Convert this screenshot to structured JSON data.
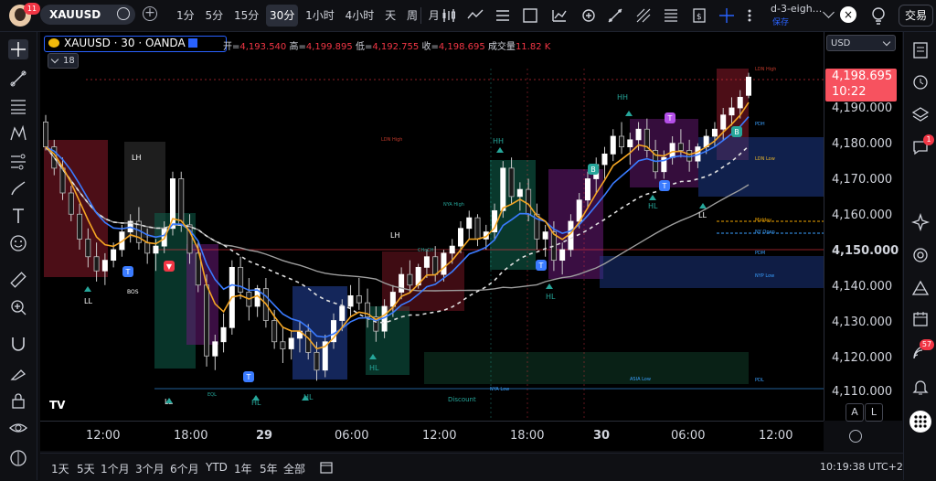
{
  "topbar": {
    "notification_count": "11",
    "symbol": "XAUUSD",
    "intervals": [
      "1分",
      "5分",
      "15分",
      "30分",
      "1小时",
      "4小时",
      "天",
      "周",
      "月"
    ],
    "active_interval": "30分",
    "layout_name": "d-3-eigh...",
    "layout_status": "保存",
    "close": "×",
    "trade_button": "交易"
  },
  "legend": {
    "title": "XAUUSD · 30 · OANDA",
    "collapse_count": "18",
    "open_label": "开=",
    "open": "4,193.540",
    "high_label": "高=",
    "high": "4,199.895",
    "low_label": "低=",
    "low": "4,192.755",
    "close_label": "收=",
    "close": "4,198.695",
    "volume_label": "成交量",
    "volume": "11.82 K"
  },
  "price_axis": {
    "currency": "USD",
    "ticks": [
      "4,190.000",
      "4,180.000",
      "4,170.000",
      "4,160.000",
      "4,150.000",
      "4,140.000",
      "4,130.000",
      "4,120.000",
      "4,110.000"
    ],
    "current_price": "4,198.695",
    "current_time": "10:22",
    "buttons": [
      "A",
      "L"
    ]
  },
  "time_axis": {
    "ticks": [
      "12:00",
      "18:00",
      "29",
      "06:00",
      "12:00",
      "18:00",
      "30",
      "06:00",
      "12:00"
    ]
  },
  "bottom": {
    "ranges": [
      "1天",
      "5天",
      "1个月",
      "3个月",
      "6个月",
      "YTD",
      "1年",
      "5年",
      "全部"
    ],
    "clock": "10:19:38 UTC+2"
  },
  "right_badges": {
    "chat": "1",
    "alerts": "57"
  },
  "chart_labels": {
    "hh": "HH",
    "lh": "LH",
    "ll": "LL",
    "hl": "HL",
    "bos": "BOS",
    "discount": "Discount",
    "ldn_high": "LDN High",
    "ldn_low": "LDN Low",
    "nyam": "NYA High",
    "nya_low": "NYA Low",
    "asia_low": "ASIA Low",
    "pdh": "PDH",
    "pdl": "PDL",
    "midday": "Midday",
    "ny_open": "NY Open",
    "pdm": "PDM",
    "nyp_low": "NYP Low",
    "eql": "EQL",
    "choch": "CHoCH"
  },
  "chart_data": {
    "type": "candlestick",
    "symbol": "XAUUSD",
    "interval": "30",
    "ylim": [
      4105,
      4202
    ],
    "candles": [
      {
        "o": 4186,
        "h": 4188,
        "l": 4178,
        "c": 4179
      },
      {
        "o": 4179,
        "h": 4181,
        "l": 4171,
        "c": 4173
      },
      {
        "o": 4173,
        "h": 4176,
        "l": 4164,
        "c": 4166
      },
      {
        "o": 4166,
        "h": 4168,
        "l": 4158,
        "c": 4160
      },
      {
        "o": 4160,
        "h": 4163,
        "l": 4150,
        "c": 4153
      },
      {
        "o": 4153,
        "h": 4156,
        "l": 4145,
        "c": 4148
      },
      {
        "o": 4148,
        "h": 4152,
        "l": 4141,
        "c": 4144
      },
      {
        "o": 4144,
        "h": 4149,
        "l": 4140,
        "c": 4147
      },
      {
        "o": 4147,
        "h": 4152,
        "l": 4145,
        "c": 4150
      },
      {
        "o": 4150,
        "h": 4157,
        "l": 4148,
        "c": 4155
      },
      {
        "o": 4155,
        "h": 4160,
        "l": 4152,
        "c": 4158
      },
      {
        "o": 4158,
        "h": 4162,
        "l": 4150,
        "c": 4152
      },
      {
        "o": 4152,
        "h": 4156,
        "l": 4146,
        "c": 4149
      },
      {
        "o": 4149,
        "h": 4153,
        "l": 4144,
        "c": 4151
      },
      {
        "o": 4151,
        "h": 4158,
        "l": 4149,
        "c": 4156
      },
      {
        "o": 4156,
        "h": 4172,
        "l": 4154,
        "c": 4170
      },
      {
        "o": 4170,
        "h": 4172,
        "l": 4155,
        "c": 4157
      },
      {
        "o": 4157,
        "h": 4160,
        "l": 4146,
        "c": 4149
      },
      {
        "o": 4149,
        "h": 4152,
        "l": 4138,
        "c": 4140
      },
      {
        "o": 4140,
        "h": 4143,
        "l": 4117,
        "c": 4120
      },
      {
        "o": 4120,
        "h": 4126,
        "l": 4116,
        "c": 4124
      },
      {
        "o": 4124,
        "h": 4132,
        "l": 4121,
        "c": 4128
      },
      {
        "o": 4128,
        "h": 4147,
        "l": 4126,
        "c": 4145
      },
      {
        "o": 4145,
        "h": 4148,
        "l": 4136,
        "c": 4138
      },
      {
        "o": 4138,
        "h": 4142,
        "l": 4130,
        "c": 4134
      },
      {
        "o": 4134,
        "h": 4140,
        "l": 4131,
        "c": 4139
      },
      {
        "o": 4139,
        "h": 4142,
        "l": 4128,
        "c": 4130
      },
      {
        "o": 4130,
        "h": 4133,
        "l": 4122,
        "c": 4124
      },
      {
        "o": 4124,
        "h": 4128,
        "l": 4118,
        "c": 4122
      },
      {
        "o": 4122,
        "h": 4127,
        "l": 4119,
        "c": 4125
      },
      {
        "o": 4125,
        "h": 4130,
        "l": 4121,
        "c": 4127
      },
      {
        "o": 4127,
        "h": 4129,
        "l": 4119,
        "c": 4121
      },
      {
        "o": 4121,
        "h": 4124,
        "l": 4113,
        "c": 4116
      },
      {
        "o": 4116,
        "h": 4126,
        "l": 4114,
        "c": 4124
      },
      {
        "o": 4124,
        "h": 4132,
        "l": 4122,
        "c": 4130
      },
      {
        "o": 4130,
        "h": 4136,
        "l": 4127,
        "c": 4134
      },
      {
        "o": 4134,
        "h": 4140,
        "l": 4131,
        "c": 4137
      },
      {
        "o": 4137,
        "h": 4142,
        "l": 4133,
        "c": 4135
      },
      {
        "o": 4135,
        "h": 4139,
        "l": 4128,
        "c": 4131
      },
      {
        "o": 4131,
        "h": 4134,
        "l": 4124,
        "c": 4127
      },
      {
        "o": 4127,
        "h": 4136,
        "l": 4125,
        "c": 4134
      },
      {
        "o": 4134,
        "h": 4140,
        "l": 4131,
        "c": 4138
      },
      {
        "o": 4138,
        "h": 4145,
        "l": 4136,
        "c": 4143
      },
      {
        "o": 4143,
        "h": 4147,
        "l": 4138,
        "c": 4140
      },
      {
        "o": 4140,
        "h": 4146,
        "l": 4139,
        "c": 4145
      },
      {
        "o": 4145,
        "h": 4150,
        "l": 4142,
        "c": 4148
      },
      {
        "o": 4148,
        "h": 4151,
        "l": 4141,
        "c": 4143
      },
      {
        "o": 4143,
        "h": 4150,
        "l": 4141,
        "c": 4149
      },
      {
        "o": 4149,
        "h": 4153,
        "l": 4146,
        "c": 4151
      },
      {
        "o": 4151,
        "h": 4158,
        "l": 4149,
        "c": 4156
      },
      {
        "o": 4156,
        "h": 4161,
        "l": 4153,
        "c": 4159
      },
      {
        "o": 4159,
        "h": 4160,
        "l": 4151,
        "c": 4153
      },
      {
        "o": 4153,
        "h": 4157,
        "l": 4150,
        "c": 4155
      },
      {
        "o": 4155,
        "h": 4163,
        "l": 4153,
        "c": 4161
      },
      {
        "o": 4161,
        "h": 4175,
        "l": 4159,
        "c": 4173
      },
      {
        "o": 4173,
        "h": 4176,
        "l": 4163,
        "c": 4165
      },
      {
        "o": 4165,
        "h": 4169,
        "l": 4161,
        "c": 4167
      },
      {
        "o": 4167,
        "h": 4170,
        "l": 4158,
        "c": 4160
      },
      {
        "o": 4160,
        "h": 4163,
        "l": 4150,
        "c": 4153
      },
      {
        "o": 4153,
        "h": 4157,
        "l": 4148,
        "c": 4155
      },
      {
        "o": 4155,
        "h": 4158,
        "l": 4144,
        "c": 4147
      },
      {
        "o": 4147,
        "h": 4152,
        "l": 4143,
        "c": 4150
      },
      {
        "o": 4150,
        "h": 4160,
        "l": 4148,
        "c": 4158
      },
      {
        "o": 4158,
        "h": 4166,
        "l": 4156,
        "c": 4164
      },
      {
        "o": 4164,
        "h": 4172,
        "l": 4162,
        "c": 4170
      },
      {
        "o": 4170,
        "h": 4176,
        "l": 4166,
        "c": 4174
      },
      {
        "o": 4174,
        "h": 4179,
        "l": 4170,
        "c": 4177
      },
      {
        "o": 4177,
        "h": 4184,
        "l": 4175,
        "c": 4182
      },
      {
        "o": 4182,
        "h": 4186,
        "l": 4177,
        "c": 4179
      },
      {
        "o": 4179,
        "h": 4183,
        "l": 4174,
        "c": 4181
      },
      {
        "o": 4181,
        "h": 4186,
        "l": 4178,
        "c": 4184
      },
      {
        "o": 4184,
        "h": 4187,
        "l": 4176,
        "c": 4178
      },
      {
        "o": 4178,
        "h": 4181,
        "l": 4170,
        "c": 4172
      },
      {
        "o": 4172,
        "h": 4178,
        "l": 4170,
        "c": 4176
      },
      {
        "o": 4176,
        "h": 4182,
        "l": 4174,
        "c": 4180
      },
      {
        "o": 4180,
        "h": 4184,
        "l": 4176,
        "c": 4178
      },
      {
        "o": 4178,
        "h": 4181,
        "l": 4172,
        "c": 4175
      },
      {
        "o": 4175,
        "h": 4180,
        "l": 4173,
        "c": 4179
      },
      {
        "o": 4179,
        "h": 4184,
        "l": 4177,
        "c": 4182
      },
      {
        "o": 4182,
        "h": 4186,
        "l": 4179,
        "c": 4184
      },
      {
        "o": 4184,
        "h": 4190,
        "l": 4181,
        "c": 4188
      },
      {
        "o": 4188,
        "h": 4193,
        "l": 4185,
        "c": 4190
      },
      {
        "o": 4190,
        "h": 4195,
        "l": 4187,
        "c": 4193
      },
      {
        "o": 4193.54,
        "h": 4199.895,
        "l": 4192.755,
        "c": 4198.695
      }
    ]
  }
}
